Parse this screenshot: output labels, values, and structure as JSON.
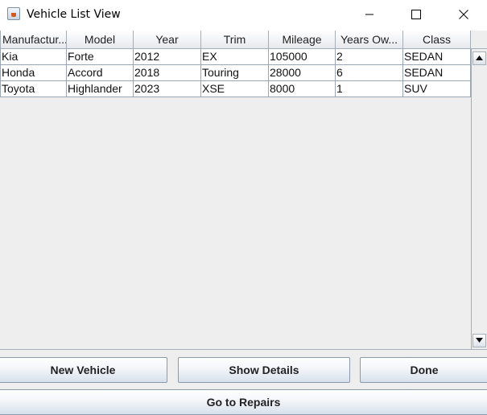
{
  "window": {
    "title": "Vehicle List View",
    "icon": "java-icon",
    "controls": [
      "minimize-icon",
      "maximize-icon",
      "close-icon"
    ]
  },
  "table": {
    "columns": [
      "Manufactur...",
      "Model",
      "Year",
      "Trim",
      "Mileage",
      "Years Ow...",
      "Class"
    ],
    "rows": [
      [
        "Kia",
        "Forte",
        "2012",
        "EX",
        "105000",
        "2",
        "SEDAN"
      ],
      [
        "Honda",
        "Accord",
        "2018",
        "Touring",
        "28000",
        "6",
        "SEDAN"
      ],
      [
        "Toyota",
        "Highlander",
        "2023",
        "XSE",
        "8000",
        "1",
        "SUV"
      ]
    ]
  },
  "buttons": {
    "new_vehicle": "New Vehicle",
    "show_details": "Show Details",
    "done": "Done",
    "go_to_repairs": "Go to Repairs"
  }
}
